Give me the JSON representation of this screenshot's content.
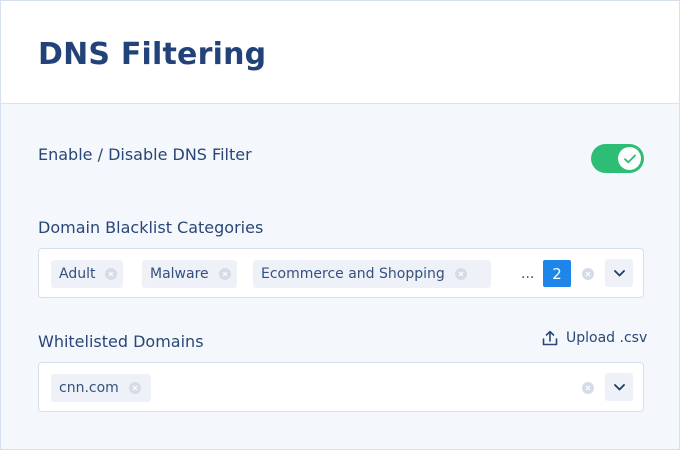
{
  "header": {
    "title": "DNS Filtering"
  },
  "dns_filter": {
    "label": "Enable / Disable DNS Filter",
    "enabled": true,
    "toggle_color": "#2ebd74"
  },
  "blacklist": {
    "label": "Domain Blacklist Categories",
    "chips": [
      "Adult",
      "Malware",
      "Ecommerce and Shopping"
    ],
    "overflow": "...",
    "more_count": "2",
    "badge_color": "#1d86e8"
  },
  "whitelist": {
    "label": "Whitelisted Domains",
    "upload_label": "Upload .csv",
    "chips": [
      "cnn.com"
    ]
  },
  "icons": {
    "toggle": "check-icon",
    "chip_remove": "close-circle-icon",
    "clear": "close-circle-icon",
    "dropdown": "chevron-down-icon",
    "upload": "upload-icon"
  }
}
